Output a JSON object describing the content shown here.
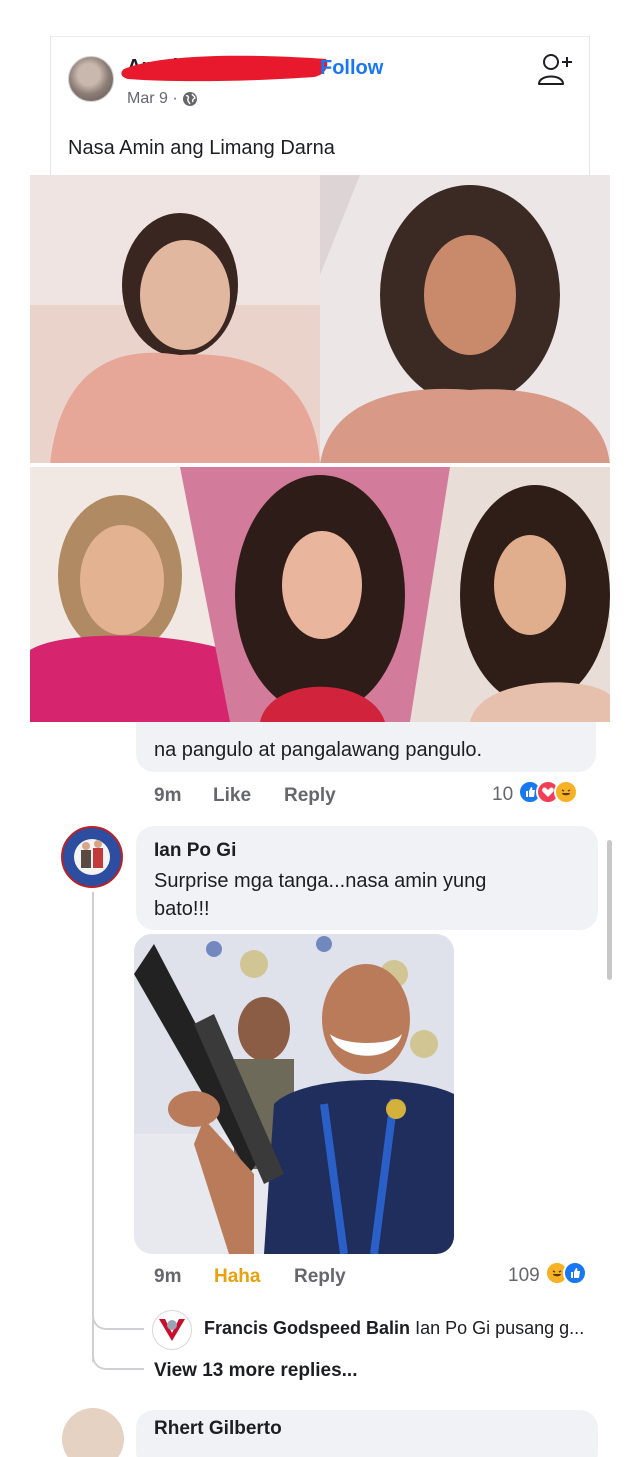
{
  "post": {
    "author": "Arnel Dela C",
    "follow": "Follow",
    "date": "Mar 9 ·",
    "text": "Nasa Amin ang Limang Darna"
  },
  "comment_1": {
    "text": "na pangulo at pangalawang pangulo.",
    "time": "9m",
    "like": "Like",
    "reply": "Reply",
    "reaction_count": "10"
  },
  "comment_2": {
    "name": "Ian Po Gi",
    "text_line1": "Surprise mga tanga...nasa amin yung",
    "text_line2": "bato!!!",
    "time": "9m",
    "reaction_label": "Haha",
    "reply": "Reply",
    "reaction_count": "109"
  },
  "reply_preview": {
    "name": "Francis Godspeed Balin",
    "text": "Ian Po Gi pusang g..."
  },
  "view_more": "View 13 more replies...",
  "next_comment": {
    "name": "Rhert Gilberto"
  },
  "colors": {
    "link_blue": "#1877f2",
    "haha_orange": "#e9a10c",
    "redaction_red": "#e8192c"
  }
}
